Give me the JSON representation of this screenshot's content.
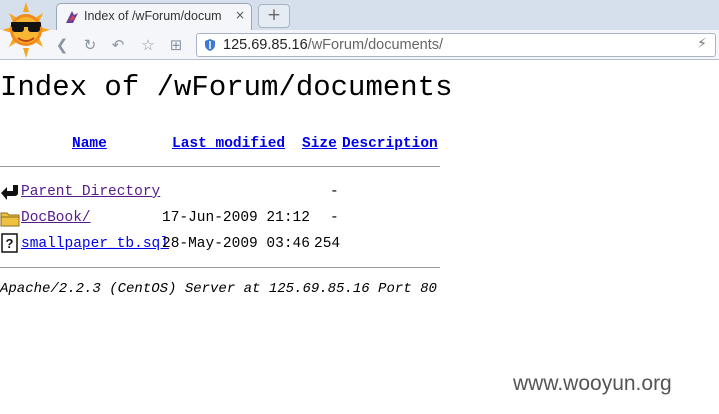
{
  "browser": {
    "tab_title": "Index of /wForum/docum",
    "tab_close_glyph": "×",
    "new_tab_glyph": "+",
    "url_host": "125.69.85.16",
    "url_path": "/wForum/documents/",
    "nav_icons": [
      "back-icon",
      "forward-icon",
      "refresh-icon",
      "undo-icon",
      "star-icon",
      "grid-icon"
    ]
  },
  "page": {
    "heading": "Index of /wForum/documents",
    "columns": {
      "name": "Name",
      "last_modified": "Last modified",
      "size": "Size",
      "description": "Description"
    },
    "rows": [
      {
        "icon": "back-arrow-icon",
        "name": "Parent Directory",
        "modified": "",
        "size": "-"
      },
      {
        "icon": "folder-icon",
        "name": "DocBook/",
        "modified": "17-Jun-2009 21:12",
        "size": "-"
      },
      {
        "icon": "unknown-file-icon",
        "name": "smallpaper_tb.sql",
        "modified": "28-May-2009 03:46",
        "size": "254"
      }
    ],
    "footer": "Apache/2.2.3 (CentOS) Server at 125.69.85.16 Port 80"
  },
  "watermark": "www.wooyun.org",
  "colors": {
    "link_visited": "#551a8b",
    "link": "#0000ee",
    "tabbar": "#d6e0ec"
  }
}
